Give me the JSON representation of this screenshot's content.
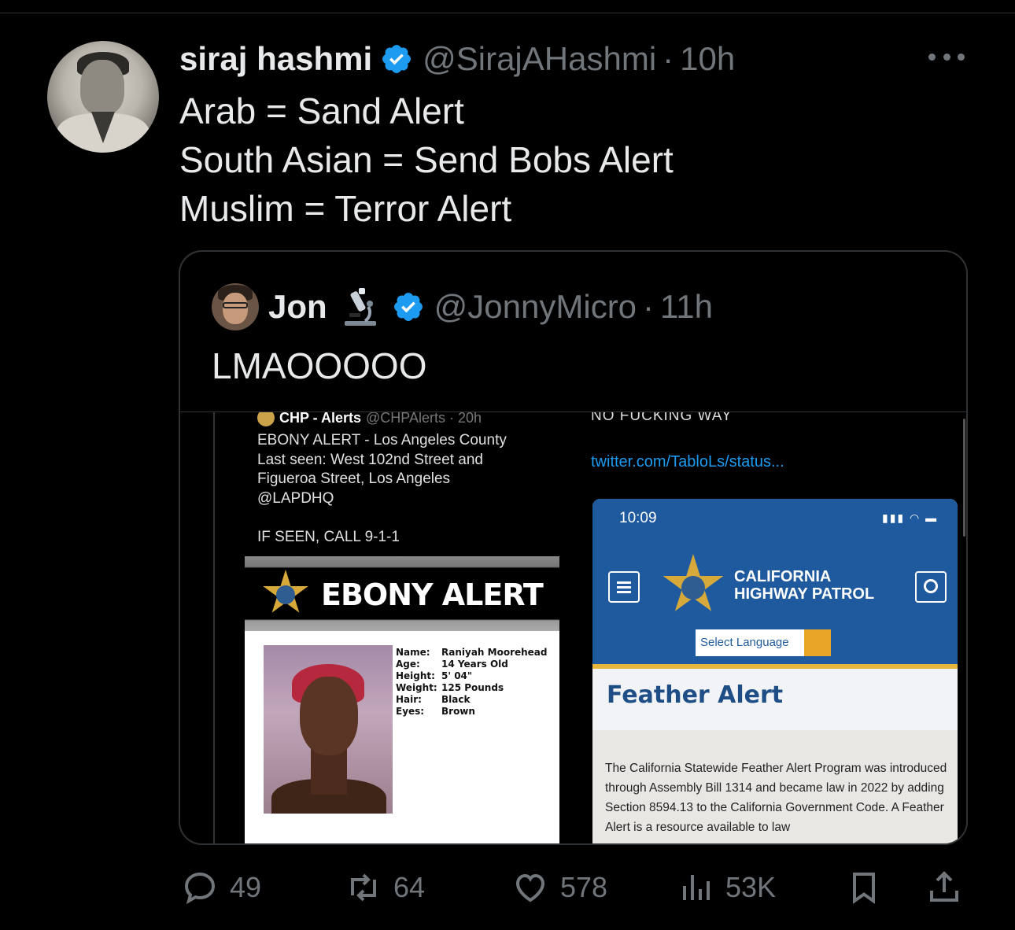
{
  "tweet": {
    "author_name": "siraj hashmi",
    "handle": "@SirajAHashmi",
    "separator": "·",
    "time": "10h",
    "lines": [
      "Arab = Sand Alert",
      "South Asian = Send Bobs Alert",
      "Muslim = Terror Alert"
    ]
  },
  "quote": {
    "author_name": "Jon",
    "handle": "@JonnyMicro",
    "separator": "·",
    "time": "11h",
    "text": "LMAOOOOO"
  },
  "media": {
    "left": {
      "account": "CHP - Alerts",
      "account_handle": "@CHPAlerts · 20h",
      "lines": [
        "EBONY ALERT - Los Angeles County",
        "Last seen:  West 102nd Street and",
        "Figueroa Street, Los Angeles",
        "@LAPDHQ"
      ],
      "if_seen": "IF SEEN, CALL 9-1-1",
      "banner": "EBONY ALERT",
      "info_keys": [
        "Name:",
        "Age:",
        "Height:",
        "Weight:",
        "Hair:",
        "Eyes:"
      ],
      "info_values": [
        "Raniyah Moorehead",
        "14 Years Old",
        "5' 04\"",
        "125 Pounds",
        "Black",
        "Brown"
      ]
    },
    "right": {
      "caption": "NO FUCKING WAY",
      "link": "twitter.com/TabloLs/status...",
      "phone_time": "10:09",
      "site_title_1": "CALIFORNIA",
      "site_title_2": "HIGHWAY PATROL",
      "language": "Select Language",
      "heading": "Feather Alert",
      "body": "The California Statewide Feather Alert Program was introduced through Assembly Bill 1314 and became law in 2022 by adding Section 8594.13 to the California Government Code. A Feather Alert is a resource available to law"
    }
  },
  "actions": {
    "replies": "49",
    "retweets": "64",
    "likes": "578",
    "views": "53K"
  },
  "colors": {
    "background": "#000000",
    "text": "#e7e9ea",
    "muted": "#71767b",
    "verified": "#1d9bf0",
    "border": "#2f3336"
  },
  "icons": [
    "verified-badge-icon",
    "more-icon",
    "microscope-icon",
    "reply-icon",
    "retweet-icon",
    "like-icon",
    "views-icon",
    "bookmark-icon",
    "share-icon"
  ]
}
